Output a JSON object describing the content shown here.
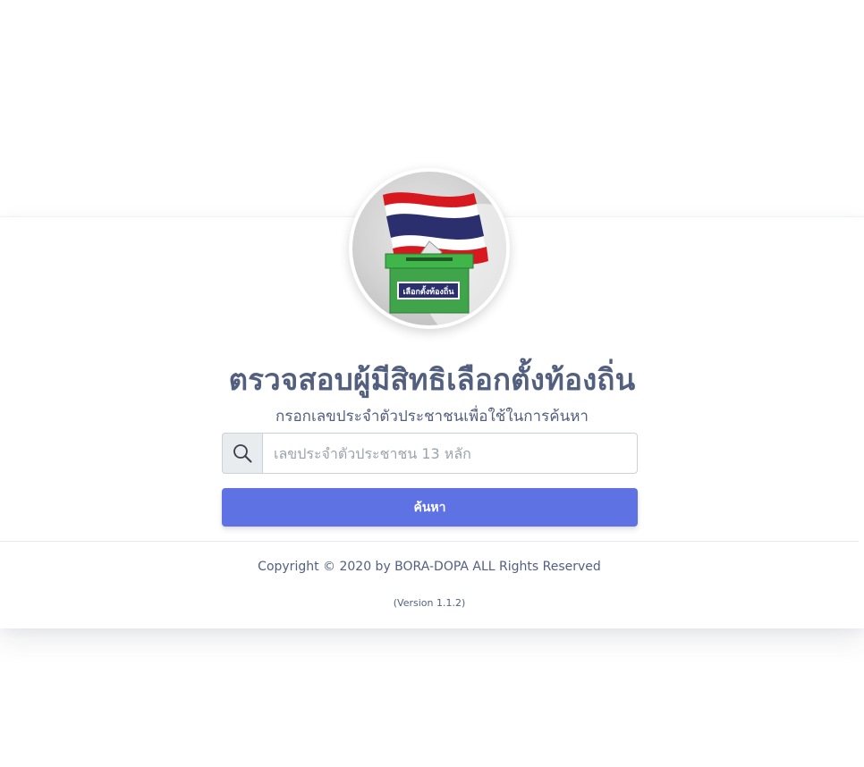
{
  "page": {
    "title": "ตรวจสอบผู้มีสิทธิเลือกตั้งท้องถิ่น",
    "subtitle": "กรอกเลขประจำตัวประชาชนเพื่อใช้ในการค้นหา",
    "logo_ballot_label": "เลือกตั้งท้องถิ่น"
  },
  "search": {
    "placeholder": "เลขประจำตัวประชาชน 13 หลัก",
    "value": "",
    "icon": "search-icon",
    "button_label": "ค้นหา"
  },
  "footer": {
    "copyright": "Copyright © 2020 by BORA-DOPA ALL Rights Reserved",
    "version": "(Version 1.1.2)"
  },
  "colors": {
    "primary": "#5e72e4",
    "text": "#525f7f",
    "flag_red": "#d7191f",
    "flag_blue": "#2b2f6e",
    "ballot_green": "#3fa44a"
  }
}
